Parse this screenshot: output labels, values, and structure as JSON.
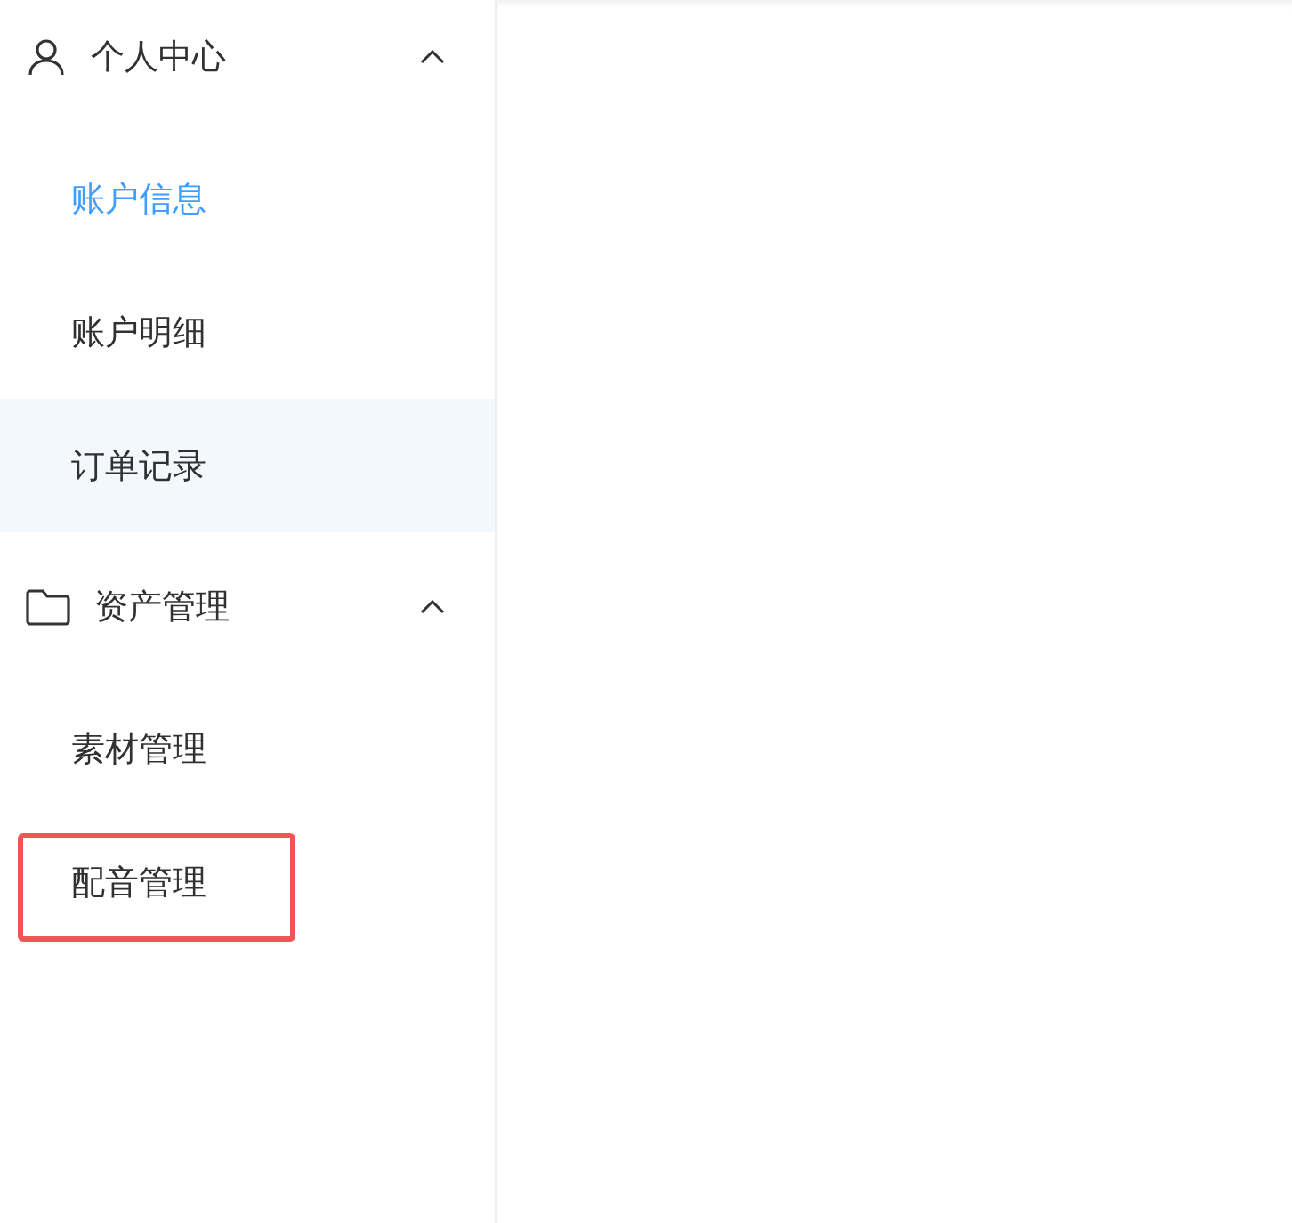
{
  "sidebar": {
    "groups": [
      {
        "title": "个人中心",
        "kind": "user",
        "expanded": true,
        "items": [
          {
            "label": "账户信息",
            "selected": true,
            "highlighted": false,
            "marked": false
          },
          {
            "label": "账户明细",
            "selected": false,
            "highlighted": false,
            "marked": false
          },
          {
            "label": "订单记录",
            "selected": false,
            "highlighted": true,
            "marked": false
          }
        ]
      },
      {
        "title": "资产管理",
        "kind": "folder",
        "expanded": true,
        "items": [
          {
            "label": "素材管理",
            "selected": false,
            "highlighted": false,
            "marked": false
          },
          {
            "label": "配音管理",
            "selected": false,
            "highlighted": false,
            "marked": true
          }
        ]
      }
    ]
  }
}
